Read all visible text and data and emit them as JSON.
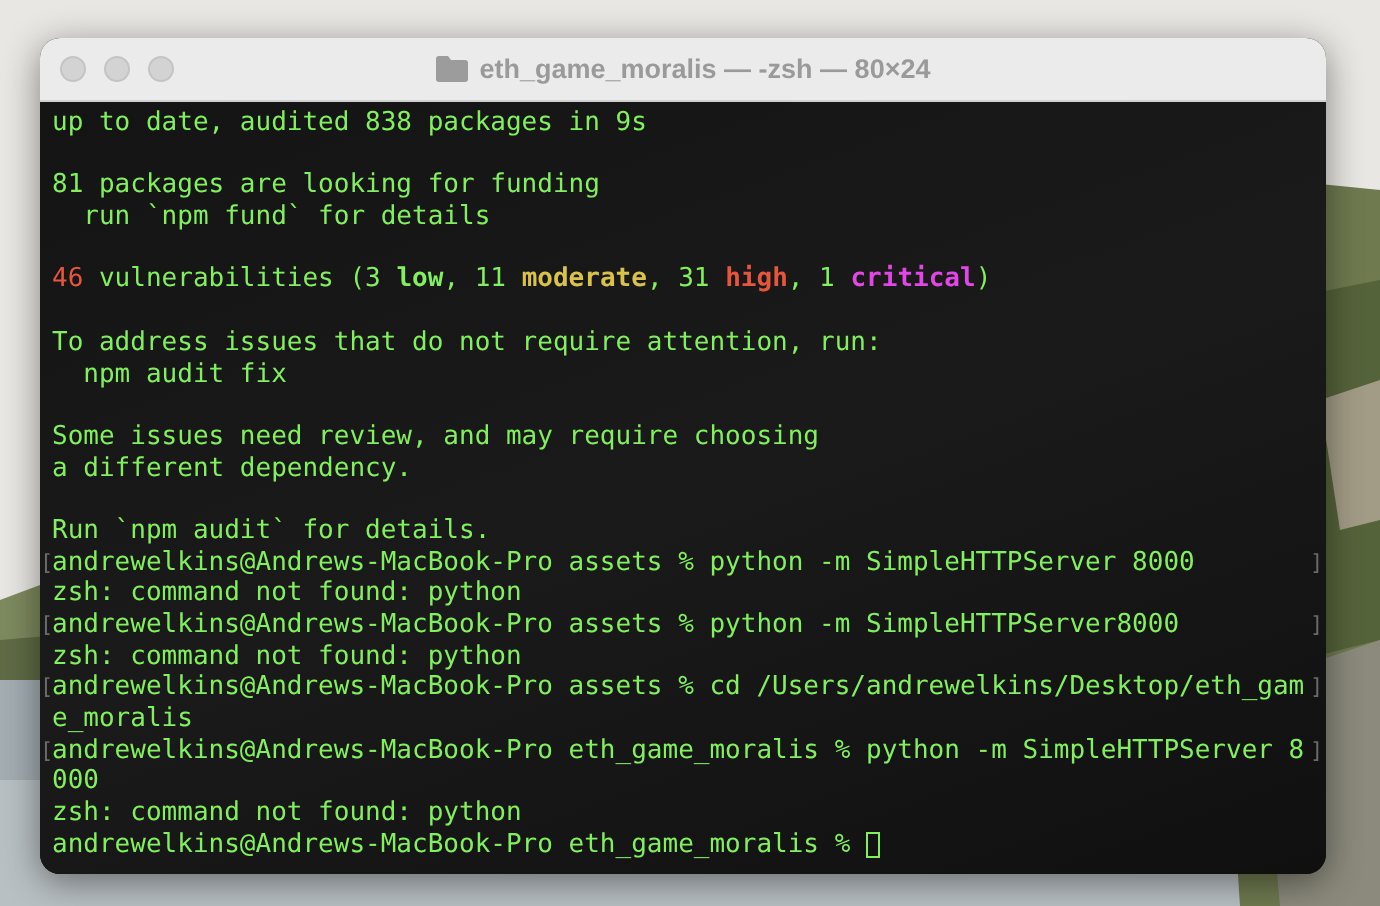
{
  "window": {
    "title": "eth_game_moralis — -zsh — 80×24"
  },
  "terminal": {
    "lines": [
      {
        "kind": "text",
        "segments": [
          {
            "kind": "plain",
            "text": "up to date, audited 838 packages in 9s"
          }
        ]
      },
      {
        "kind": "blank"
      },
      {
        "kind": "text",
        "segments": [
          {
            "kind": "plain",
            "text": "81 packages are looking for funding"
          }
        ]
      },
      {
        "kind": "text",
        "segments": [
          {
            "kind": "plain",
            "text": "  run `npm fund` for details"
          }
        ]
      },
      {
        "kind": "blank"
      },
      {
        "kind": "text",
        "segments": [
          {
            "kind": "count",
            "text": "46"
          },
          {
            "kind": "plain",
            "text": " vulnerabilities (3 "
          },
          {
            "kind": "low",
            "text": "low"
          },
          {
            "kind": "plain",
            "text": ", 11 "
          },
          {
            "kind": "moderate",
            "text": "moderate"
          },
          {
            "kind": "plain",
            "text": ", 31 "
          },
          {
            "kind": "high",
            "text": "high"
          },
          {
            "kind": "plain",
            "text": ", 1 "
          },
          {
            "kind": "critical",
            "text": "critical"
          },
          {
            "kind": "plain",
            "text": ")"
          }
        ]
      },
      {
        "kind": "blank"
      },
      {
        "kind": "text",
        "segments": [
          {
            "kind": "plain",
            "text": "To address issues that do not require attention, run:"
          }
        ]
      },
      {
        "kind": "text",
        "segments": [
          {
            "kind": "plain",
            "text": "  npm audit fix"
          }
        ]
      },
      {
        "kind": "blank"
      },
      {
        "kind": "text",
        "segments": [
          {
            "kind": "plain",
            "text": "Some issues need review, and may require choosing"
          }
        ]
      },
      {
        "kind": "text",
        "segments": [
          {
            "kind": "plain",
            "text": "a different dependency."
          }
        ]
      },
      {
        "kind": "blank"
      },
      {
        "kind": "text",
        "segments": [
          {
            "kind": "plain",
            "text": "Run `npm audit` for details."
          }
        ]
      },
      {
        "kind": "text",
        "mark_left": "[",
        "mark_right": "]",
        "segments": [
          {
            "kind": "plain",
            "text": "andrewelkins@Andrews-MacBook-Pro assets % python -m SimpleHTTPServer 8000"
          }
        ]
      },
      {
        "kind": "text",
        "segments": [
          {
            "kind": "plain",
            "text": "zsh: command not found: python"
          }
        ]
      },
      {
        "kind": "text",
        "mark_left": "[",
        "mark_right": "]",
        "segments": [
          {
            "kind": "plain",
            "text": "andrewelkins@Andrews-MacBook-Pro assets % python -m SimpleHTTPServer8000"
          }
        ]
      },
      {
        "kind": "text",
        "segments": [
          {
            "kind": "plain",
            "text": "zsh: command not found: python"
          }
        ]
      },
      {
        "kind": "text",
        "mark_left": "[",
        "mark_right": "]",
        "segments": [
          {
            "kind": "plain",
            "text": "andrewelkins@Andrews-MacBook-Pro assets % cd /Users/andrewelkins/Desktop/eth_gam"
          }
        ]
      },
      {
        "kind": "text",
        "segments": [
          {
            "kind": "plain",
            "text": "e_moralis"
          }
        ]
      },
      {
        "kind": "text",
        "mark_left": "[",
        "mark_right": "]",
        "segments": [
          {
            "kind": "plain",
            "text": "andrewelkins@Andrews-MacBook-Pro eth_game_moralis % python -m SimpleHTTPServer 8"
          }
        ]
      },
      {
        "kind": "text",
        "segments": [
          {
            "kind": "plain",
            "text": "000"
          }
        ]
      },
      {
        "kind": "text",
        "segments": [
          {
            "kind": "plain",
            "text": "zsh: command not found: python"
          }
        ]
      },
      {
        "kind": "text",
        "cursor": true,
        "segments": [
          {
            "kind": "plain",
            "text": "andrewelkins@Andrews-MacBook-Pro eth_game_moralis % "
          }
        ]
      }
    ]
  }
}
